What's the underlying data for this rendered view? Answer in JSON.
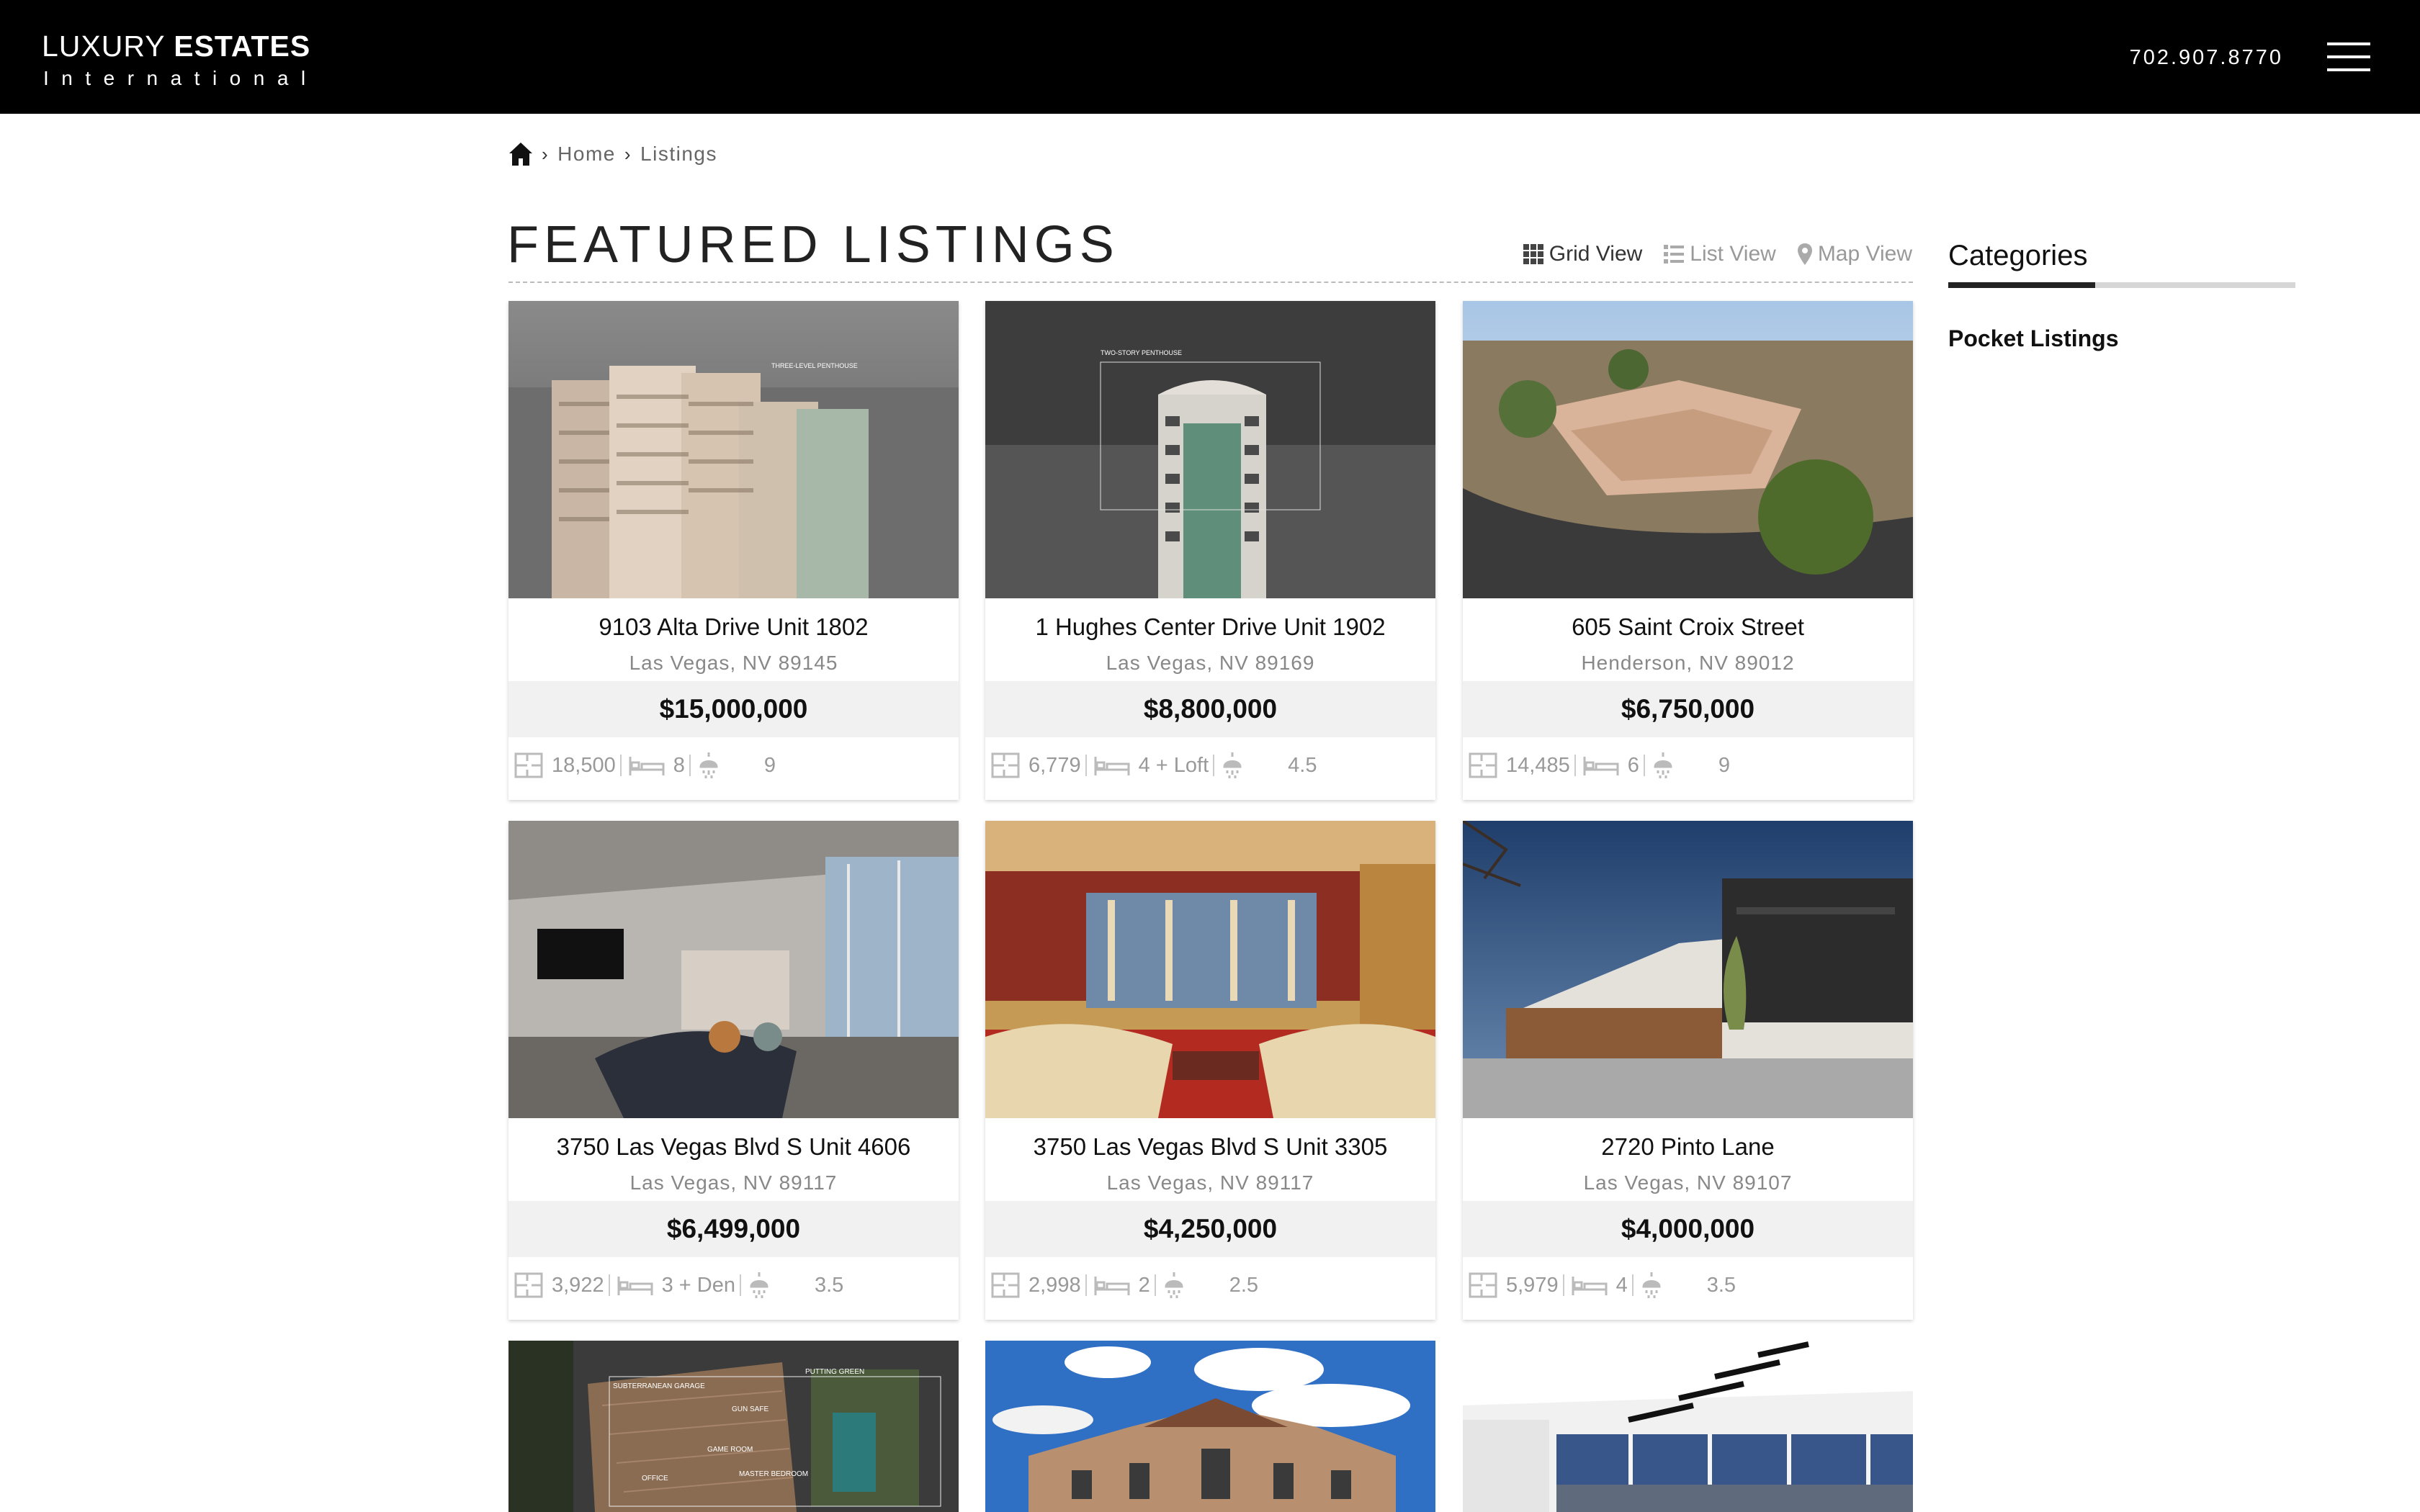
{
  "header": {
    "logo_line1_light": "LUXURY ",
    "logo_line1_bold": "ESTATES",
    "logo_line2": "International",
    "phone": "702.907.8770"
  },
  "breadcrumb": {
    "home": "Home",
    "current": "Listings"
  },
  "page": {
    "title": "FEATURED LISTINGS"
  },
  "views": {
    "grid": "Grid View",
    "list": "List View",
    "map": "Map View"
  },
  "sidebar": {
    "title": "Categories",
    "items": [
      "Pocket Listings"
    ]
  },
  "listings": [
    {
      "address": "9103 Alta Drive Unit 1802",
      "city": "Las Vegas, NV 89145",
      "price": "$15,000,000",
      "sqft": "18,500",
      "beds": "8",
      "baths": "9",
      "photo_caption": "THREE-LEVEL PENTHOUSE"
    },
    {
      "address": "1 Hughes Center Drive Unit 1902",
      "city": "Las Vegas, NV 89169",
      "price": "$8,800,000",
      "sqft": "6,779",
      "beds": "4 + Loft",
      "baths": "4.5",
      "photo_caption": "TWO-STORY PENTHOUSE"
    },
    {
      "address": "605 Saint Croix Street",
      "city": "Henderson, NV 89012",
      "price": "$6,750,000",
      "sqft": "14,485",
      "beds": "6",
      "baths": "9"
    },
    {
      "address": "3750 Las Vegas Blvd S Unit 4606",
      "city": "Las Vegas, NV 89117",
      "price": "$6,499,000",
      "sqft": "3,922",
      "beds": "3 + Den",
      "baths": "3.5"
    },
    {
      "address": "3750 Las Vegas Blvd S Unit 3305",
      "city": "Las Vegas, NV 89117",
      "price": "$4,250,000",
      "sqft": "2,998",
      "beds": "2",
      "baths": "2.5"
    },
    {
      "address": "2720 Pinto Lane",
      "city": "Las Vegas, NV 89107",
      "price": "$4,000,000",
      "sqft": "5,979",
      "beds": "4",
      "baths": "3.5"
    }
  ],
  "partial_cards": [
    {
      "photo_labels": [
        "SUBTERRANEAN GARAGE",
        "PUTTING GREEN",
        "GUN SAFE",
        "GAME ROOM",
        "OFFICE",
        "MASTER BEDROOM"
      ]
    },
    {},
    {}
  ]
}
